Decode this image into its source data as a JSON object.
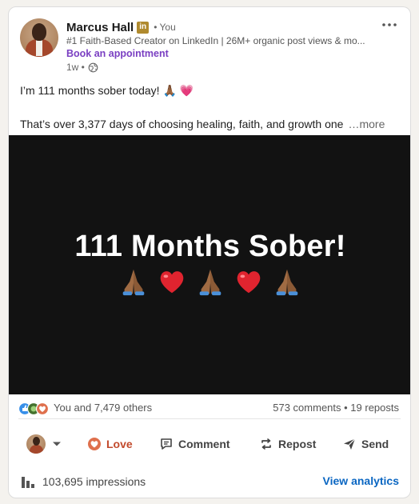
{
  "author": {
    "name": "Marcus Hall",
    "badge": "in",
    "relation": "• You",
    "headline": "#1 Faith-Based Creator on LinkedIn | 26M+ organic post views & mo...",
    "cta": "Book an appointment",
    "time": "1w •",
    "visibility_icon": "globe-icon"
  },
  "post": {
    "line1": "I’m 111 months sober today! 🙏🏾 💗",
    "line2": "That’s over 3,377 days of choosing healing, faith, and growth one",
    "more": "…more"
  },
  "media": {
    "title": "111 Months Sober!",
    "emojis": [
      "praying-hands",
      "red-heart",
      "praying-hands",
      "red-heart",
      "praying-hands"
    ]
  },
  "social": {
    "reactions_text": "You and 7,479 others",
    "counts_text": "573 comments • 19 reposts"
  },
  "actions": {
    "love": "Love",
    "comment": "Comment",
    "repost": "Repost",
    "send": "Send"
  },
  "footer": {
    "impressions": "103,695 impressions",
    "analytics": "View analytics"
  },
  "colors": {
    "brand_link": "#0a66c2",
    "cta_purple": "#7a3fc2",
    "love_red": "#c24a2c",
    "media_bg": "#121212"
  }
}
